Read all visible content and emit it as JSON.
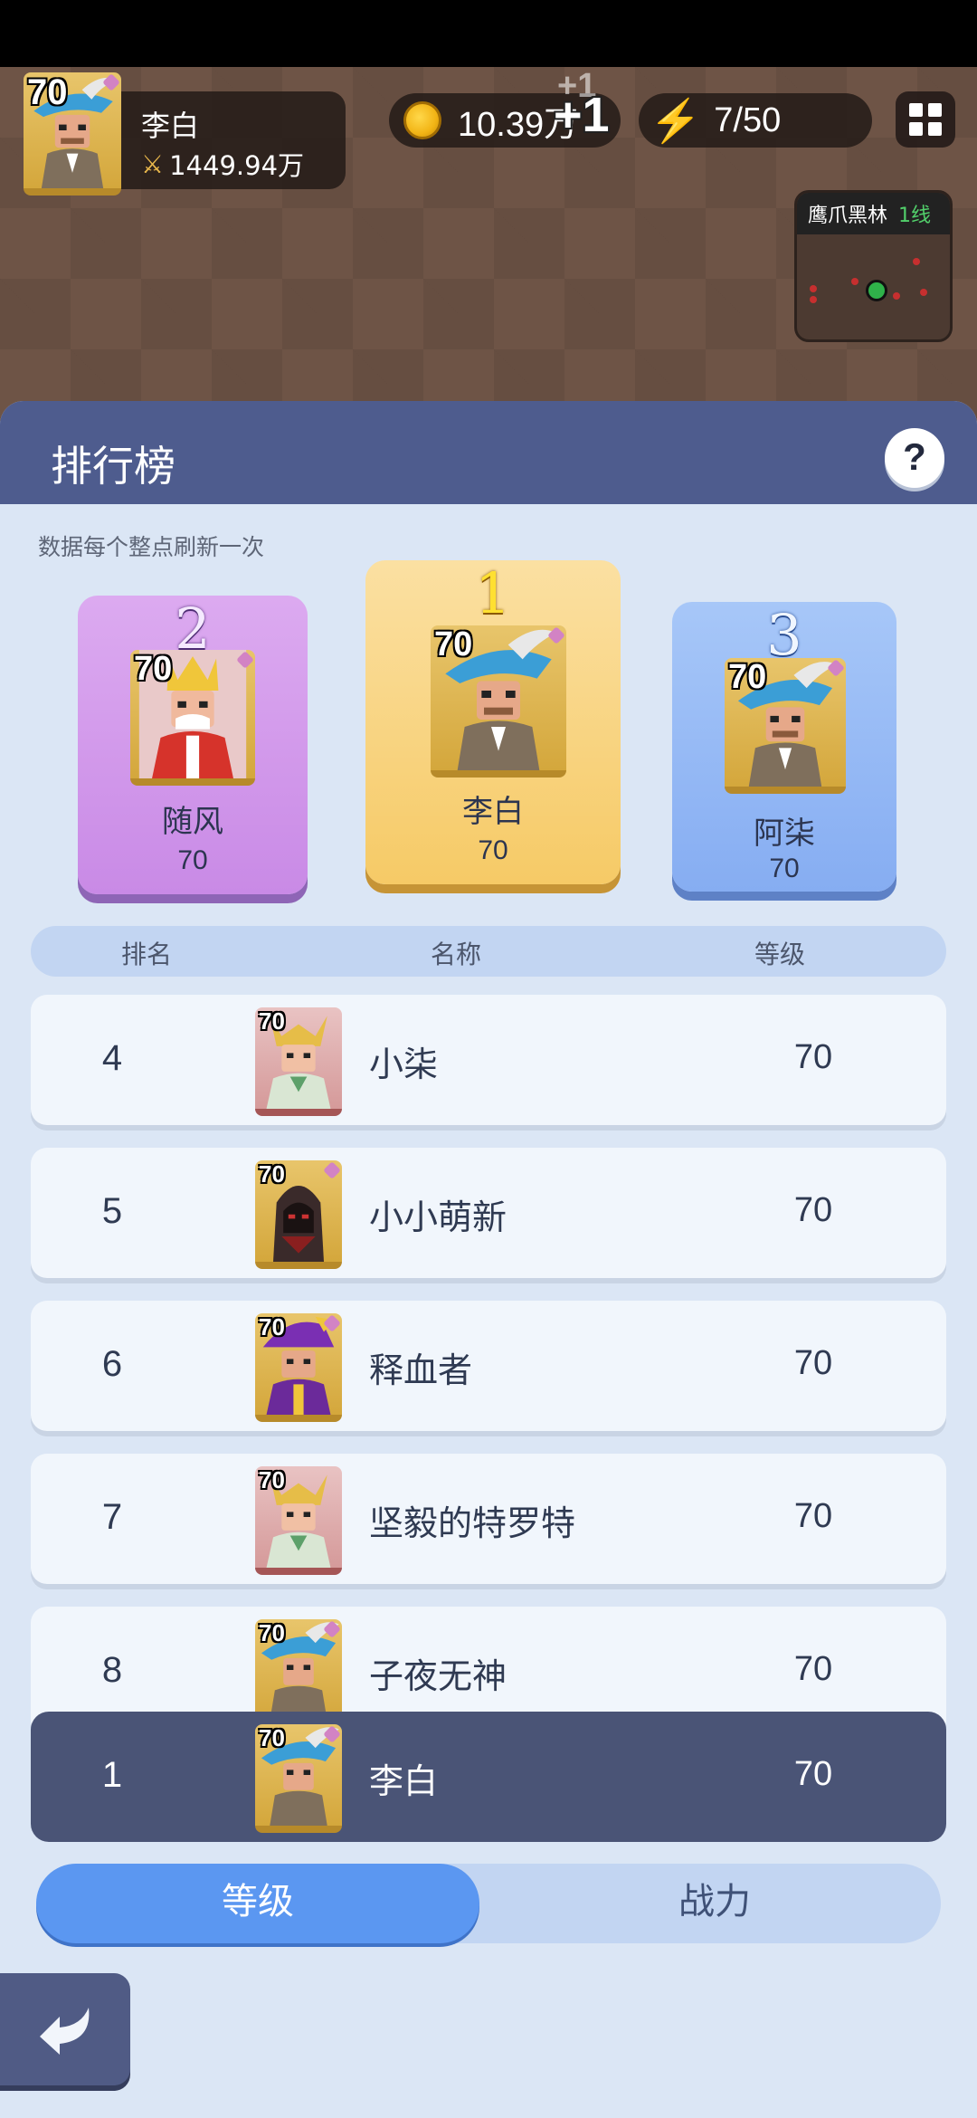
{
  "hud": {
    "player_level": "70",
    "player_name": "李白",
    "combat_power": "1449.94万",
    "gold": "10.39万",
    "gold_gain": "+1",
    "gold_gain_ghost": "+1",
    "energy": "7/50"
  },
  "minimap": {
    "area": "鹰爪黑林",
    "line": "1线"
  },
  "panel": {
    "title": "排行榜",
    "help": "?",
    "refresh_note": "数据每个整点刷新一次"
  },
  "podium": [
    {
      "rank": "2",
      "name": "随风",
      "level": "70",
      "avatar_level": "70"
    },
    {
      "rank": "1",
      "name": "李白",
      "level": "70",
      "avatar_level": "70"
    },
    {
      "rank": "3",
      "name": "阿柒",
      "level": "70",
      "avatar_level": "70"
    }
  ],
  "columns": {
    "rank": "排名",
    "name": "名称",
    "level": "等级"
  },
  "rows": [
    {
      "rank": "4",
      "name": "小柒",
      "level": "70",
      "avatar_level": "70"
    },
    {
      "rank": "5",
      "name": "小小萌新",
      "level": "70",
      "avatar_level": "70"
    },
    {
      "rank": "6",
      "name": "释血者",
      "level": "70",
      "avatar_level": "70"
    },
    {
      "rank": "7",
      "name": "坚毅的特罗特",
      "level": "70",
      "avatar_level": "70"
    },
    {
      "rank": "8",
      "name": "子夜无神",
      "level": "70",
      "avatar_level": "70"
    }
  ],
  "my_row": {
    "rank": "1",
    "name": "李白",
    "level": "70",
    "avatar_level": "70"
  },
  "tabs": {
    "level": "等级",
    "power": "战力"
  },
  "colors": {
    "panel_header": "#4e5c8e",
    "panel_bg": "#dbe6f5",
    "tab_active": "#5b97f1",
    "my_row": "#4a5476",
    "rank1_card": "#f6ca66",
    "rank2_card": "#c98ae6",
    "rank3_card": "#86adf2"
  },
  "icons": {
    "gold": "gold-coin-icon",
    "energy": "lightning-bolt-icon",
    "menu": "grid-menu-icon",
    "power": "crossed-swords-icon",
    "back": "back-arrow-icon",
    "help": "question-mark-icon"
  }
}
